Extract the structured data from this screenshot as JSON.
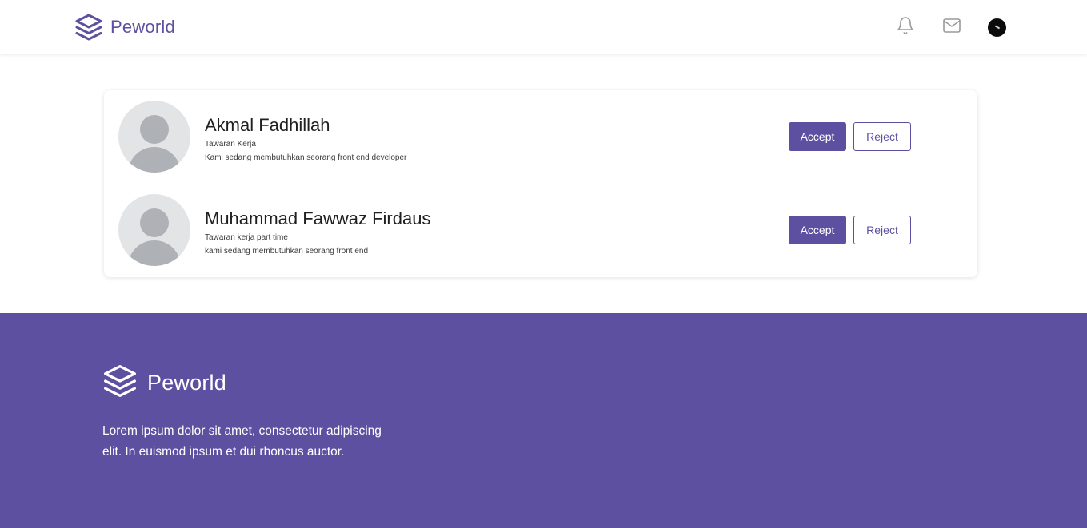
{
  "navbar": {
    "brand_name": "Peworld",
    "icons": {
      "notification": "bell-icon",
      "messages": "mail-icon"
    }
  },
  "offers": [
    {
      "name": "Akmal Fadhillah",
      "title": "Tawaran Kerja",
      "description": "Kami sedang membutuhkan seorang front end developer",
      "accept_label": "Accept",
      "reject_label": "Reject"
    },
    {
      "name": "Muhammad Fawwaz Firdaus",
      "title": "Tawaran kerja part time",
      "description": "kami sedang membutuhkan seorang front end",
      "accept_label": "Accept",
      "reject_label": "Reject"
    }
  ],
  "footer": {
    "brand_name": "Peworld",
    "description": "Lorem ipsum dolor sit amet, consectetur adipiscing elit. In euismod ipsum et dui rhoncus auctor."
  },
  "colors": {
    "primary": "#5E50A1",
    "avatar_bg": "#e3e4e6",
    "avatar_fg": "#aeb1b5",
    "icon_gray": "#9a9a9a"
  }
}
